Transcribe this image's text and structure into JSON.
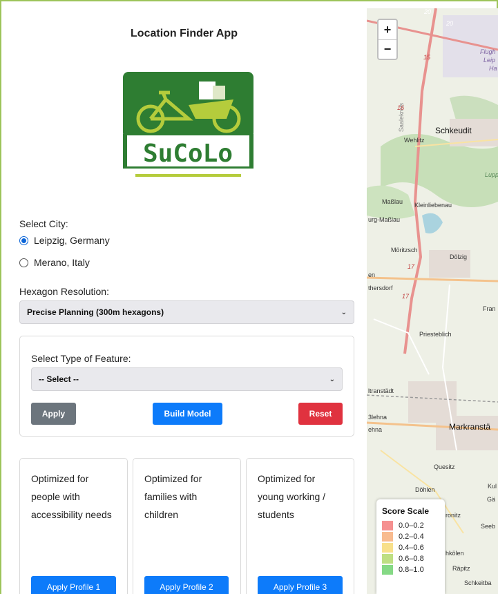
{
  "app": {
    "title": "Location Finder App"
  },
  "logo": {
    "text": "SuCoLo",
    "colors": {
      "green": "#2e7d32",
      "lime": "#b5cc3c"
    }
  },
  "city": {
    "label": "Select City:",
    "options": [
      {
        "label": "Leipzig, Germany",
        "selected": true
      },
      {
        "label": "Merano, Italy",
        "selected": false
      }
    ]
  },
  "resolution": {
    "label": "Hexagon Resolution:",
    "selected": "Precise Planning (300m hexagons)"
  },
  "feature": {
    "label": "Select Type of Feature:",
    "selected": "-- Select --",
    "apply_label": "Apply",
    "build_label": "Build Model",
    "reset_label": "Reset"
  },
  "profiles": [
    {
      "text": "Optimized for people with accessibility needs",
      "button": "Apply Profile 1"
    },
    {
      "text": "Optimized for families with children",
      "button": "Apply Profile 2"
    },
    {
      "text": "Optimized for young working / students",
      "button": "Apply Profile 3"
    }
  ],
  "map": {
    "zoom_in": "+",
    "zoom_out": "−",
    "places": [
      "Schkeudit",
      "Wehlitz",
      "Maßlau",
      "Kleinliebenau",
      "urg-Maßlau",
      "Möritzsch",
      "Dölzig",
      "thersdorf",
      "Fran",
      "Priesteblich",
      "ltranstädt",
      "Markranstä",
      "Quesitz",
      "Döhlen",
      "Kul",
      "Gä",
      "ronitz",
      "Seeb",
      "hkölen",
      "Räpitz",
      "Schkeitba",
      "Saalekreis",
      "Lupp",
      "Flugh",
      "Leip",
      "Ha",
      "3lehna",
      "ehna",
      "en"
    ],
    "road_numbers": [
      "20",
      "20",
      "15",
      "16",
      "17",
      "17"
    ]
  },
  "legend": {
    "title": "Score Scale",
    "items": [
      {
        "label": "0.0–0.2",
        "color": "#f26b6b"
      },
      {
        "label": "0.2–0.4",
        "color": "#f5a46a"
      },
      {
        "label": "0.4–0.6",
        "color": "#f6d564"
      },
      {
        "label": "0.6–0.8",
        "color": "#a8d45a"
      },
      {
        "label": "0.8–1.0",
        "color": "#5ccc5c"
      }
    ]
  }
}
